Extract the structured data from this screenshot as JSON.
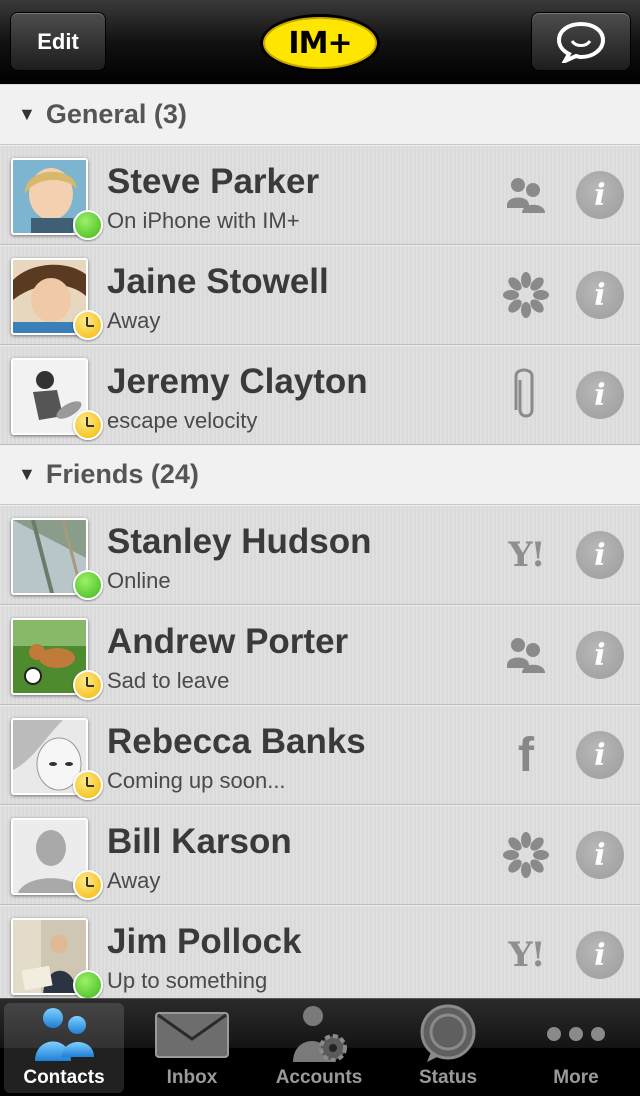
{
  "header": {
    "edit_label": "Edit",
    "logo_text": "IM+",
    "compose_icon": "chat-bubble-icon"
  },
  "groups": [
    {
      "label": "General (3)",
      "contacts": [
        {
          "name": "Steve Parker",
          "status_text": "On iPhone with IM+",
          "status": "online",
          "service": "group-icon"
        },
        {
          "name": "Jaine Stowell",
          "status_text": "Away",
          "status": "away",
          "service": "icq-flower-icon"
        },
        {
          "name": "Jeremy Clayton",
          "status_text": "escape velocity",
          "status": "away",
          "service": "paperclip-icon"
        }
      ]
    },
    {
      "label": "Friends (24)",
      "contacts": [
        {
          "name": "Stanley Hudson",
          "status_text": "Online",
          "status": "online",
          "service": "yahoo-icon"
        },
        {
          "name": "Andrew Porter",
          "status_text": "Sad to leave",
          "status": "away",
          "service": "group-icon"
        },
        {
          "name": "Rebecca Banks",
          "status_text": "Coming up soon...",
          "status": "away",
          "service": "facebook-icon"
        },
        {
          "name": "Bill Karson",
          "status_text": "Away",
          "status": "away",
          "service": "icq-flower-icon"
        },
        {
          "name": "Jim Pollock",
          "status_text": "Up to something",
          "status": "online",
          "service": "yahoo-icon"
        }
      ]
    }
  ],
  "service_labels": {
    "yahoo": "Y!",
    "facebook": "f",
    "info": "i"
  },
  "tabs": [
    {
      "label": "Contacts",
      "icon": "contacts-icon",
      "active": true
    },
    {
      "label": "Inbox",
      "icon": "envelope-icon",
      "active": false
    },
    {
      "label": "Accounts",
      "icon": "accounts-gear-icon",
      "active": false
    },
    {
      "label": "Status",
      "icon": "status-bubble-icon",
      "active": false
    },
    {
      "label": "More",
      "icon": "more-dots-icon",
      "active": false
    }
  ],
  "colors": {
    "online": "#3fb818",
    "away": "#f2b800",
    "logo_yellow": "#ffe600"
  }
}
